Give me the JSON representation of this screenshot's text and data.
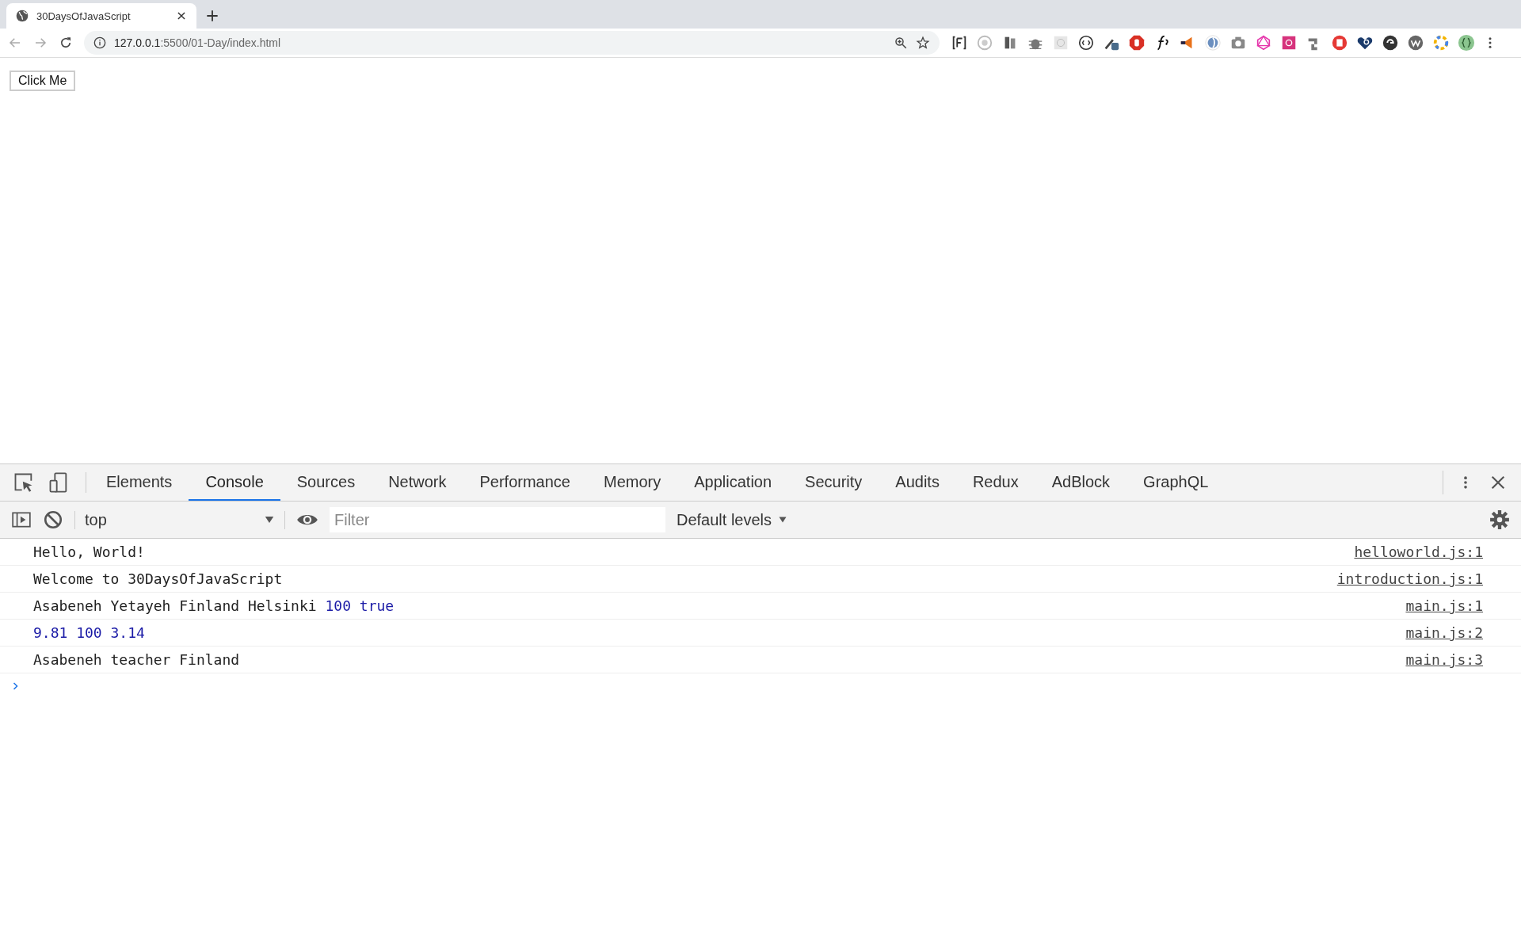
{
  "browser": {
    "tabs": [
      {
        "title": "30DaysOfJavaScript",
        "selected": true
      }
    ],
    "address": {
      "host": "127.0.0.1",
      "path": ":5500/01-Day/index.html"
    }
  },
  "page": {
    "button": "Click Me"
  },
  "devtools": {
    "tabs": [
      {
        "label": "Elements",
        "selected": false
      },
      {
        "label": "Console",
        "selected": true
      },
      {
        "label": "Sources",
        "selected": false
      },
      {
        "label": "Network",
        "selected": false
      },
      {
        "label": "Performance",
        "selected": false
      },
      {
        "label": "Memory",
        "selected": false
      },
      {
        "label": "Application",
        "selected": false
      },
      {
        "label": "Security",
        "selected": false
      },
      {
        "label": "Audits",
        "selected": false
      },
      {
        "label": "Redux",
        "selected": false
      },
      {
        "label": "AdBlock",
        "selected": false
      },
      {
        "label": "GraphQL",
        "selected": false
      }
    ],
    "console_toolbar": {
      "context": "top",
      "filter_placeholder": "Filter",
      "levels": "Default levels"
    },
    "messages": [
      {
        "parts": [
          {
            "kind": "text",
            "text": "Hello, World!"
          }
        ],
        "source": "helloworld.js:1"
      },
      {
        "parts": [
          {
            "kind": "text",
            "text": "Welcome to 30DaysOfJavaScript"
          }
        ],
        "source": "introduction.js:1"
      },
      {
        "parts": [
          {
            "kind": "text",
            "text": "Asabeneh Yetayeh Finland Helsinki "
          },
          {
            "kind": "value",
            "text": "100 true"
          }
        ],
        "source": "main.js:1"
      },
      {
        "parts": [
          {
            "kind": "value",
            "text": "9.81 100 3.14"
          }
        ],
        "source": "main.js:2"
      },
      {
        "parts": [
          {
            "kind": "text",
            "text": "Asabeneh teacher Finland"
          }
        ],
        "source": "main.js:3"
      }
    ]
  }
}
